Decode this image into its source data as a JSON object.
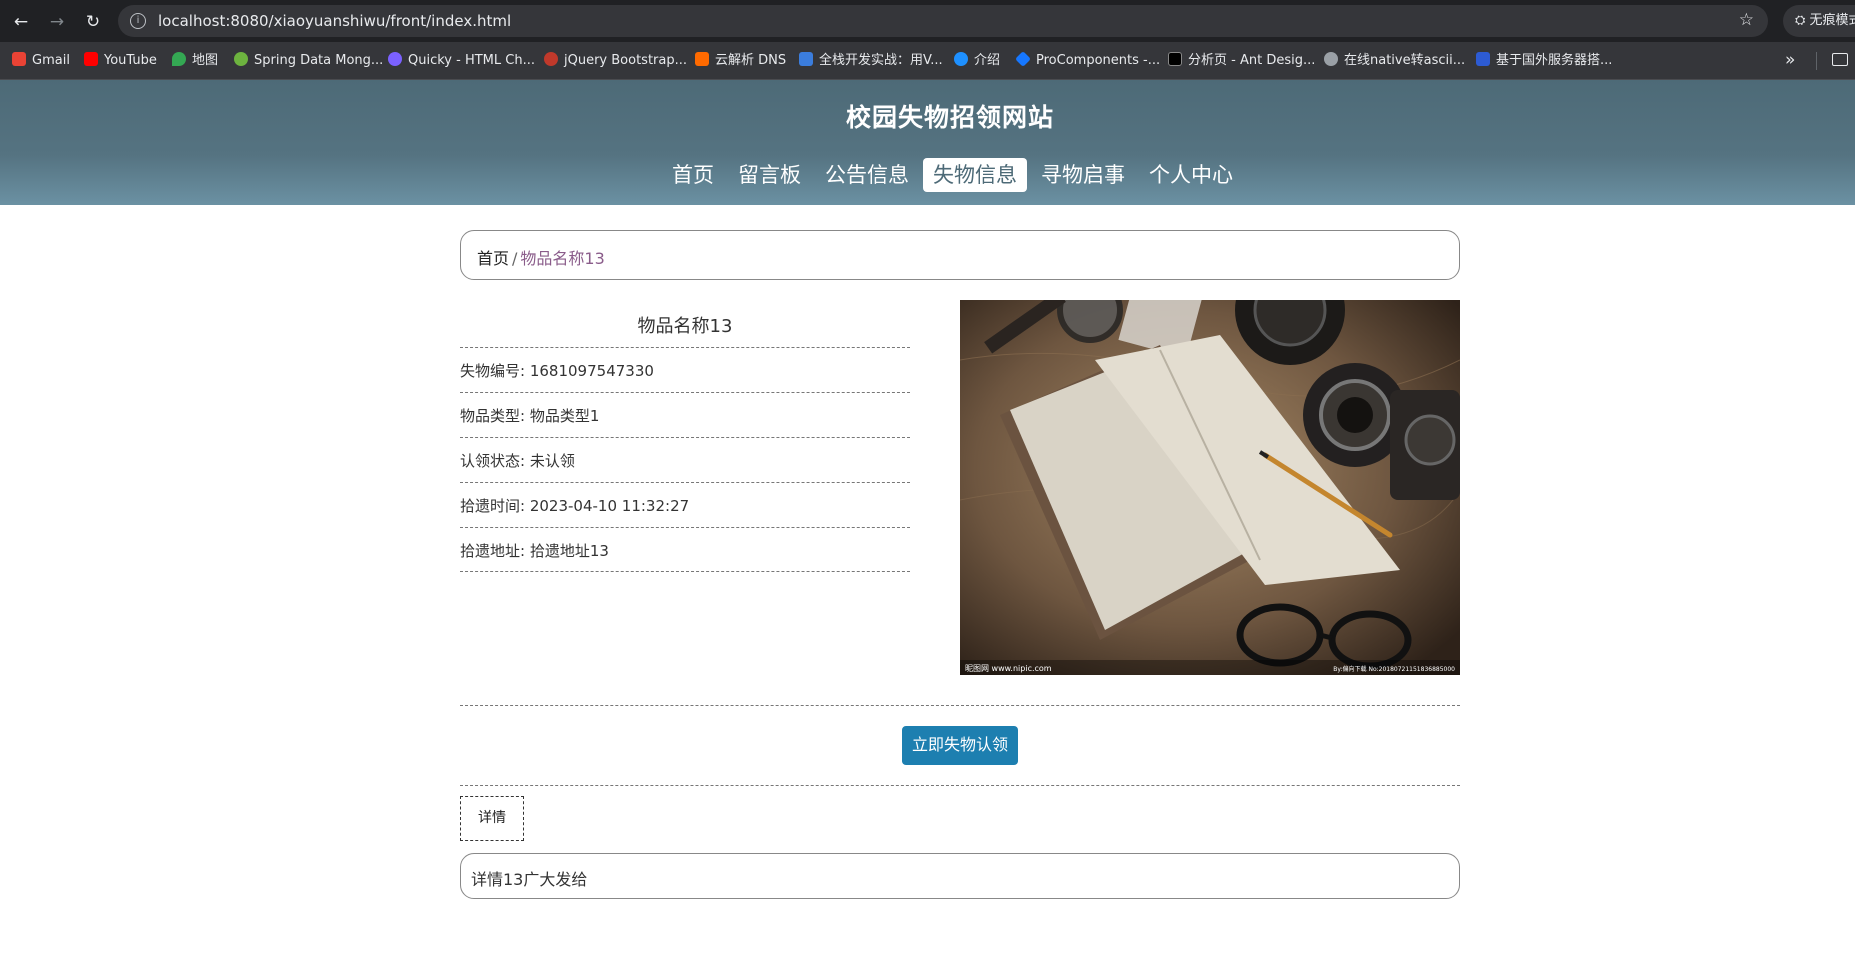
{
  "browser": {
    "url": "localhost:8080/xiaoyuanshiwu/front/index.html",
    "profile_label": "无痕模式"
  },
  "bookmarks": [
    {
      "label": "Gmail",
      "color": "#ea4335"
    },
    {
      "label": "YouTube",
      "color": "#ff0000"
    },
    {
      "label": "地图",
      "color": "#34a853"
    },
    {
      "label": "Spring Data Mong...",
      "color": "#6db33f"
    },
    {
      "label": "Quicky - HTML Ch...",
      "color": "#7b61ff"
    },
    {
      "label": "jQuery Bootstrap...",
      "color": "#c0392b"
    },
    {
      "label": "云解析 DNS",
      "color": "#ff6a00"
    },
    {
      "label": "全栈开发实战：用V...",
      "color": "#3b7ddd"
    },
    {
      "label": "介绍",
      "color": "#1e90ff"
    },
    {
      "label": "ProComponents -...",
      "color": "#1677ff"
    },
    {
      "label": "分析页 - Ant Desig...",
      "color": "#000000"
    },
    {
      "label": "在线native转ascii...",
      "color": "#9aa0a6"
    },
    {
      "label": "基于国外服务器搭...",
      "color": "#2d5bd3"
    }
  ],
  "site": {
    "title": "校园失物招领网站",
    "menu": [
      {
        "label": "首页",
        "active": false
      },
      {
        "label": "留言板",
        "active": false
      },
      {
        "label": "公告信息",
        "active": false
      },
      {
        "label": "失物信息",
        "active": true
      },
      {
        "label": "寻物启事",
        "active": false
      },
      {
        "label": "个人中心",
        "active": false
      }
    ]
  },
  "breadcrumb": {
    "home": "首页",
    "separator": "/",
    "current": "物品名称13"
  },
  "item": {
    "name": "物品名称13",
    "fields": [
      {
        "label": "失物编号",
        "value": "1681097547330"
      },
      {
        "label": "物品类型",
        "value": "物品类型1"
      },
      {
        "label": "认领状态",
        "value": "未认领"
      },
      {
        "label": "拾遗时间",
        "value": "2023-04-10 11:32:27"
      },
      {
        "label": "拾遗地址",
        "value": "拾遗地址13"
      }
    ],
    "photo_watermark_left": "昵图网 www.nipic.com",
    "photo_watermark_right": "By:偏向下载 No:20180721151836885000"
  },
  "actions": {
    "claim_label": "立即失物认领"
  },
  "tabs": {
    "detail_label": "详情"
  },
  "detail": {
    "content": "详情13广大发给"
  }
}
